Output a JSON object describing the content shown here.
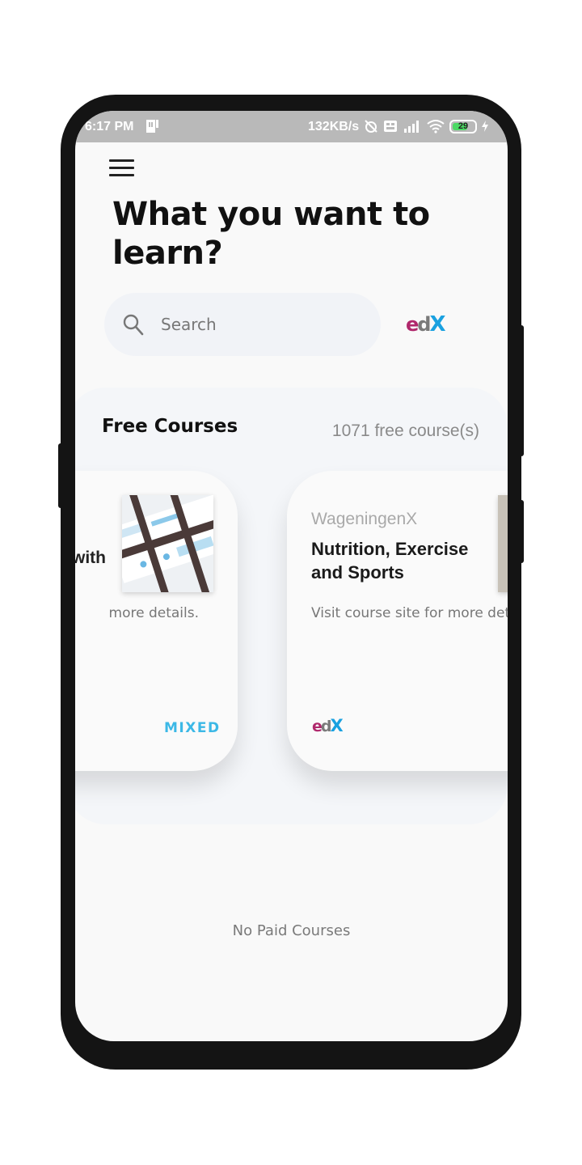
{
  "status_bar": {
    "time": "6:17 PM",
    "network_speed": "132KB/s",
    "battery_level": "29",
    "icons": [
      "sim-card-icon",
      "alarm-off-icon",
      "volte-icon",
      "signal-icon",
      "wifi-icon",
      "battery-icon",
      "charging-icon"
    ]
  },
  "header": {
    "menu_icon": "hamburger-menu-icon",
    "headline": "What you want to learn?"
  },
  "search": {
    "placeholder": "Search",
    "value": ""
  },
  "provider_logo": {
    "e": "e",
    "d": "d",
    "x": "X"
  },
  "free_courses": {
    "title": "Free Courses",
    "count_text": "1071 free course(s)",
    "cards": [
      {
        "title_fragment": "with",
        "description_fragment": "more details.",
        "badge": "MIXED"
      },
      {
        "organization": "WageningenX",
        "title": "Nutrition, Exercise and Sports",
        "description": "Visit course site for more details.",
        "logo": {
          "e": "e",
          "d": "d",
          "x": "X"
        }
      }
    ]
  },
  "paid_courses": {
    "empty_text": "No Paid Courses"
  },
  "colors": {
    "status_bar": "#b9b9b9",
    "background": "#f9f9f9",
    "accent_blue": "#3cb8e6",
    "edx_magenta": "#b0286c",
    "edx_blue": "#1aa1e0"
  }
}
